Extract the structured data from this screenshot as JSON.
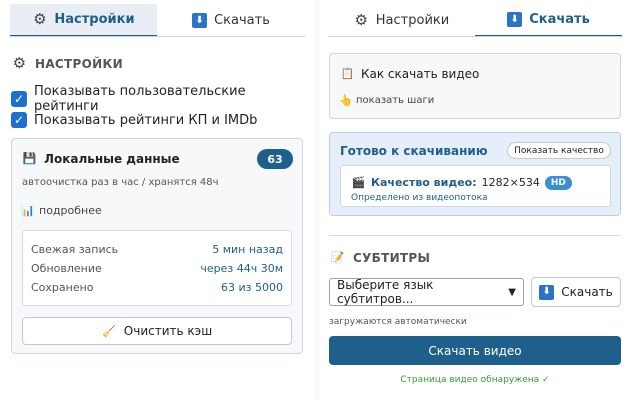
{
  "left": {
    "tabs": [
      {
        "label": "Настройки",
        "icon": "gear-icon"
      },
      {
        "label": "Скачать",
        "icon": "download-icon"
      }
    ],
    "section_title": "НАСТРОЙКИ",
    "checkboxes": [
      {
        "label": "Показывать пользовательские рейтинги",
        "checked": true
      },
      {
        "label": "Показывать рейтинги КП и IMDb",
        "checked": true
      }
    ],
    "local_data": {
      "title": "Локальные данные",
      "count": "63",
      "subtitle": "автоочистка раз в час / хранятся 48ч",
      "details_link": "подробнее",
      "stats": [
        {
          "key": "Свежая запись",
          "value": "5 мин назад"
        },
        {
          "key": "Обновление",
          "value": "через 44ч 30м"
        },
        {
          "key": "Сохранено",
          "value": "63 из 5000"
        }
      ],
      "clear_button": "Очистить кэш"
    }
  },
  "right": {
    "tabs": [
      {
        "label": "Настройки",
        "icon": "gear-icon"
      },
      {
        "label": "Скачать",
        "icon": "download-icon"
      }
    ],
    "howto": {
      "title": "Как скачать видео",
      "link": "показать шаги"
    },
    "ready": {
      "title": "Готово к скачиванию",
      "show_quality_button": "Показать качество",
      "quality_label": "Качество видео:",
      "quality_value": "1282×534",
      "quality_badge": "HD",
      "detected_note": "Определено из видеопотока"
    },
    "subtitles": {
      "section_title": "СУБТИТРЫ",
      "select_value": "Выберите язык субтитров...",
      "download_button": "Скачать",
      "note": "загружаются автоматически"
    },
    "download_video_button": "Скачать видео",
    "status": "Страница видео обнаружена ✓"
  },
  "colors": {
    "accent": "#1f5f8b",
    "checkbox": "#1f6fd1",
    "ready_bg": "#e6eefa",
    "status": "#3a9a3a"
  }
}
